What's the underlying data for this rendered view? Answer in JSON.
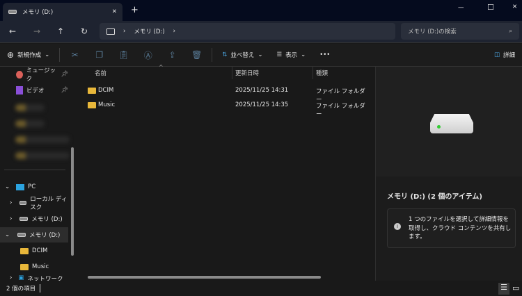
{
  "tab": {
    "title": "メモリ (D:)",
    "close": "✕",
    "new": "+"
  },
  "window": {
    "minimize": "—",
    "maximize": "☐",
    "close": "✕"
  },
  "nav": {
    "back": "←",
    "forward": "→",
    "up": "↑",
    "refresh": "↻",
    "breadcrumb": [
      "メモリ (D:)"
    ],
    "search_placeholder": "メモリ (D:)の検索"
  },
  "toolbar": {
    "new": "新規作成",
    "sort": "並べ替え",
    "view": "表示",
    "more": "•••",
    "details": "詳細"
  },
  "sidebar": {
    "quick": [
      {
        "label": "ミュージック"
      },
      {
        "label": "ビデオ"
      }
    ],
    "pc": "PC",
    "local": "ローカル ディスク",
    "mem1": "メモリ (D:)",
    "mem2": "メモリ (D:)",
    "dcim": "DCIM",
    "music": "Music",
    "network": "ネットワーク"
  },
  "list": {
    "columns": [
      "名前",
      "更新日時",
      "種類"
    ],
    "rows": [
      {
        "name": "DCIM",
        "date": "2025/11/25 14:31",
        "type": "ファイル フォルダー"
      },
      {
        "name": "Music",
        "date": "2025/11/25 14:35",
        "type": "ファイル フォルダー"
      }
    ]
  },
  "preview": {
    "title": "メモリ (D:) (2 個のアイテム)",
    "info": "1 つのファイルを選択して詳細情報を取得し、クラウド コンテンツを共有します。"
  },
  "status": {
    "count": "2 個の項目"
  }
}
